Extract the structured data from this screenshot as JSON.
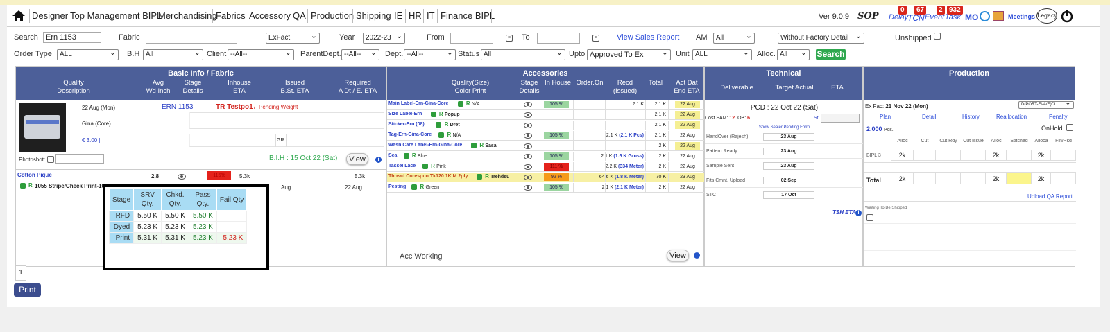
{
  "nav": {
    "items": [
      "Designer",
      "Top Management BIPL",
      "Merchandising",
      "Fabrics",
      "Accessory",
      "QA",
      "Production",
      "Shipping",
      "IE",
      "HR",
      "IT",
      "Finance BIPL"
    ],
    "version": "Ver 9.0.9",
    "sop": "SOP",
    "delay": "Delay",
    "tcn": "TCN",
    "event": "Event",
    "task": "Task",
    "mo": "MO",
    "meetings": "Meetings",
    "legacy": "Legacy",
    "badges": {
      "delay": "0",
      "tcn": "67",
      "event": "2",
      "task": "932"
    }
  },
  "filters": {
    "search_label": "Search",
    "search_value": "Ern 1153",
    "fabric_label": "Fabric",
    "fabric_value": "",
    "exfact": "ExFact.",
    "year_label": "Year",
    "year_value": "2022-23",
    "from_label": "From",
    "to_label": "To",
    "view_sales_report": "View Sales Report",
    "am_label": "AM",
    "am_value": "All",
    "factory_detail": "Without Factory Detail",
    "unshipped_label": "Unshipped",
    "ordertype_label": "Order Type",
    "ordertype_value": "ALL",
    "bh_label": "B.H",
    "bh_value": "All",
    "client_label": "Client",
    "client_value": "--All--",
    "parentdept_label": "ParentDept.",
    "parentdept_value": "--All--",
    "dept_label": "Dept.",
    "dept_value": "--All--",
    "status_label": "Status",
    "status_value": "All",
    "upto_label": "Upto",
    "upto_value": "Approved To Ex",
    "unit_label": "Unit",
    "unit_value": "ALL",
    "alloc_label": "Alloc.",
    "alloc_value": "All",
    "search_button": "Search"
  },
  "basic": {
    "title": "Basic Info / Fabric",
    "cols": [
      "Quality\nDescription",
      "Avg\nWd Inch",
      "Stage\nDetails",
      "Inhouse\nETA",
      "Issued\nB.St. ETA",
      "Required\nA Dt / E. ETA"
    ],
    "date": "22 Aug (Mon)",
    "ern": "ERN 1153",
    "tr": "TR Testpo1",
    "sep": "/",
    "pending": "Pending Weight",
    "gina": "Gina (Core)",
    "price": "€ 3.00 |",
    "gr": "GR",
    "photoshot": "Photoshot:",
    "bih": "B.I.H : 15 Oct 22 (Sat)",
    "view": "View",
    "fabric_name": "Cotton Pique",
    "fabric_avg": "2.8",
    "fabric_pct": "115%",
    "fabric_qty": "5.3k",
    "fabric_req": "5.3k",
    "fabric_desc": "1055 Stripe/Check Print-1055",
    "fabric_aug1": "Aug",
    "fabric_aug2": "22 Aug"
  },
  "popup": {
    "headers": [
      "Stage",
      "SRV\nQty.",
      "Chkd.\nQty.",
      "Pass\nQty.",
      "Fail Qty"
    ],
    "rows": [
      [
        "RFD",
        "5.50 K",
        "5.50 K",
        "5.50 K",
        ""
      ],
      [
        "Dyed",
        "5.23 K",
        "5.23 K",
        "5.23 K",
        ""
      ],
      [
        "Print",
        "5.31 K",
        "5.31 K",
        "5.23 K",
        "5.23 K"
      ]
    ]
  },
  "acc": {
    "title": "Accessories",
    "cols": [
      "Quality(Size)\nColor Print",
      "Stage\nDetails",
      "In House",
      "Order.On",
      "Recd\n(Issued)",
      "Total",
      "Act Dat\nEnd ETA"
    ],
    "rows": [
      {
        "name": "Main Label-Ern-Gina-Core",
        "tag": "N/A",
        "pct": "105 %",
        "recd": "2.1 K",
        "total": "2.1 K",
        "date": "22 Aug"
      },
      {
        "name": "Size Label-Ern",
        "tag": "Popup",
        "pct": "",
        "recd": "",
        "total": "2.1 K",
        "date": "22 Aug"
      },
      {
        "name": "Sticker-Ern (08)",
        "tag": "Dret",
        "pct": "",
        "recd": "",
        "total": "2.1 K",
        "date": "22 Aug"
      },
      {
        "name": "Tag-Ern-Gina-Core",
        "tag": "N/A",
        "pct": "105 %",
        "recd": "2.1 K (2.1 K Pcs)",
        "total": "2.1 K",
        "date": "22 Aug"
      },
      {
        "name": "Wash Care Label-Ern-Gina-Core",
        "tag": "Sasa",
        "pct": "",
        "recd": "",
        "total": "2 K",
        "date": "22 Aug"
      },
      {
        "name": "Seal",
        "tag": "Blue",
        "pct": "105 %",
        "recd": "2.1 K (1.6 K Gross)",
        "total": "2 K",
        "date": "22 Aug"
      },
      {
        "name": "Tassel Lace",
        "tag": "Pink",
        "pct": "111 %",
        "recd": "2.2 K (334 Meter)",
        "total": "2 K",
        "date": "22 Aug"
      },
      {
        "name": "Thread Corespun Tk120 1K M 2ply",
        "tag": "Trehdsu",
        "pct": "92 %",
        "recd": "64.6 K (1.8 K Meter)",
        "total": "70 K",
        "date": "23 Aug"
      },
      {
        "name": "Pesting",
        "tag": "Green",
        "pct": "105 %",
        "recd": "2.1 K (2.1 K Meter)",
        "total": "2 K",
        "date": "22 Aug"
      }
    ],
    "working": "Acc Working",
    "view": "View"
  },
  "tech": {
    "title": "Technical",
    "cols": [
      "Deliverable",
      "Target Actual",
      "ETA"
    ],
    "pcd": "PCD : 22 Oct 22 (Sat)",
    "costsam": "Cost.SAM:",
    "costsam_v": "12",
    "ob": "OB:",
    "ob_v": "6",
    "st": "St:",
    "show_pending": "Show Sealer Pending Form",
    "rows": [
      {
        "label": "HandOver (Rajesh)",
        "date": "23 Aug"
      },
      {
        "label": "Pattern Ready",
        "date": "23 Aug"
      },
      {
        "label": "Sample Sent",
        "date": "23 Aug"
      },
      {
        "label": "Fits Cmnt. Upload",
        "date": "02 Sep"
      },
      {
        "label": "STC",
        "date": "17 Oct"
      }
    ],
    "tsheta": "TSH ETA"
  },
  "prod": {
    "title": "Production",
    "exfac": "Ex Fac:",
    "exfac_date": "21 Nov 22 (Mon)",
    "dport": "D(PORT-FI-A/F(CI",
    "links": [
      "Plan",
      "Detail",
      "History",
      "Reallocation",
      "Penalty"
    ],
    "pcs": "2,000",
    "pcs_unit": "Pcs.",
    "onhold": "OnHold",
    "cols": [
      "Alloc",
      "Cut",
      "Cut Rdy",
      "Cut Issue",
      "Alloc",
      "Stitched",
      "Alloca",
      "Fin/Pkd"
    ],
    "bipl": "BIPL 3",
    "bipl_vals": [
      "2k",
      "",
      "",
      "",
      "2k",
      "",
      "2k",
      ""
    ],
    "total": "Total",
    "total_vals": [
      "2k",
      "",
      "",
      "",
      "2k",
      "",
      "2k",
      ""
    ],
    "upload_qa": "Upload QA Report",
    "waiting": "Waiting To Be Shipped"
  },
  "pager": {
    "page": "1"
  },
  "print": "Print"
}
